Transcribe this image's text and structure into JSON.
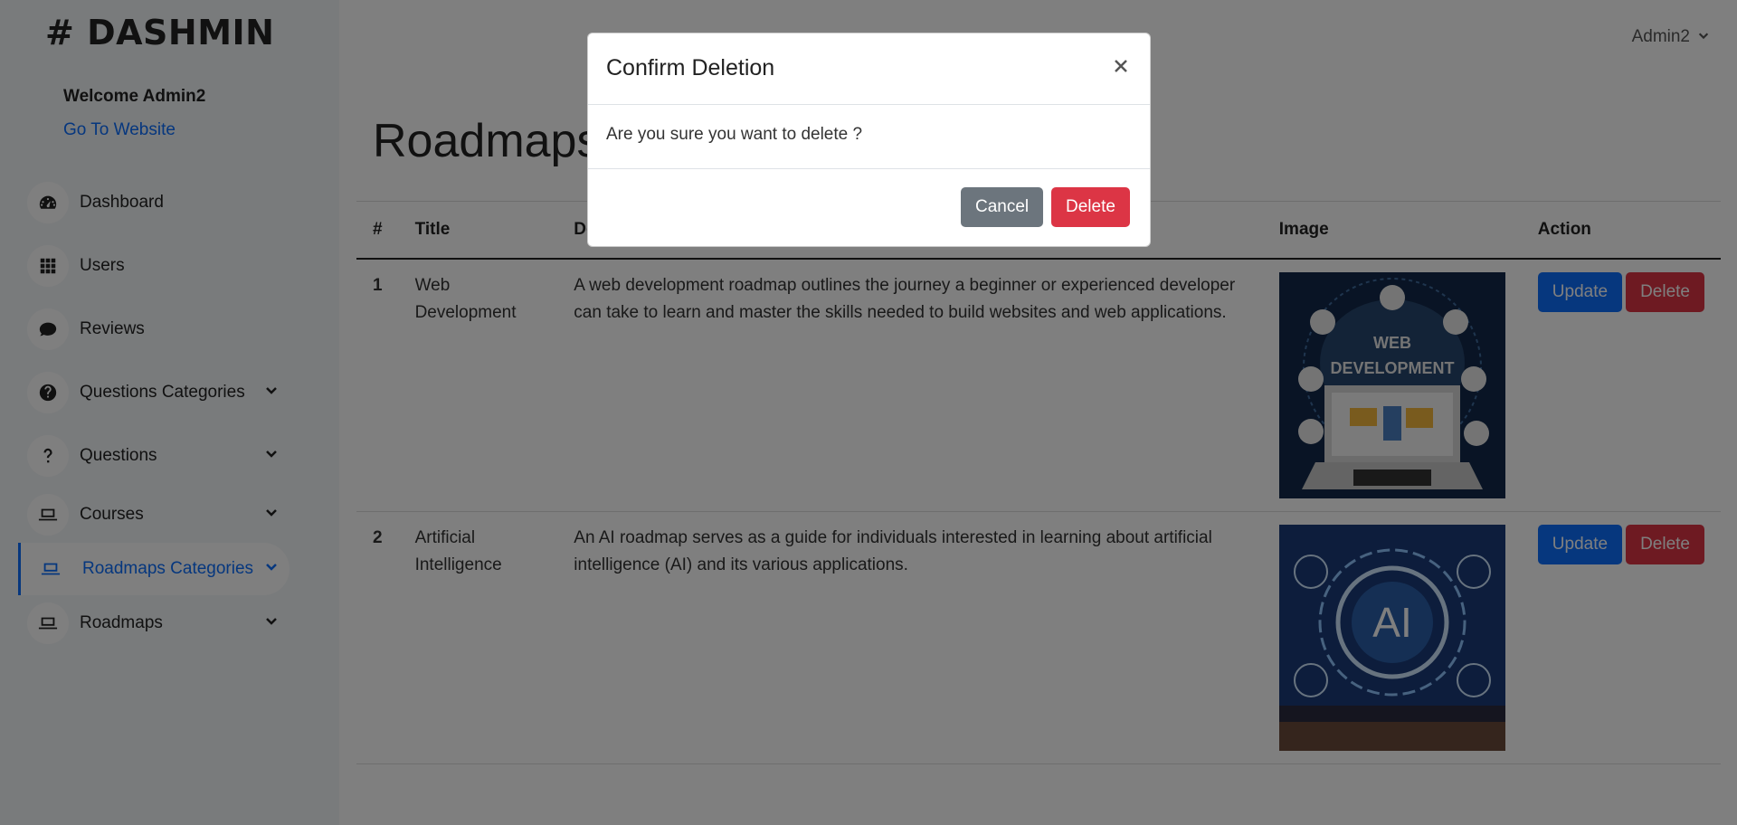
{
  "brand": {
    "title": "# DASHMIN"
  },
  "sidebar": {
    "welcome": "Welcome Admin2",
    "go_to_website": "Go To Website",
    "items": [
      {
        "label": "Dashboard",
        "icon": "dashboard-icon"
      },
      {
        "label": "Users",
        "icon": "grid-icon"
      },
      {
        "label": "Reviews",
        "icon": "comment-icon"
      },
      {
        "label": "Questions Categories",
        "icon": "question-circle-icon"
      },
      {
        "label": "Questions",
        "icon": "question-icon"
      },
      {
        "label": "Courses",
        "icon": "laptop-icon"
      },
      {
        "label": "Roadmaps Categories",
        "icon": "laptop-icon"
      },
      {
        "label": "Roadmaps",
        "icon": "laptop-icon"
      }
    ],
    "active": "Roadmaps Categories"
  },
  "topbar": {
    "user": "Admin2"
  },
  "page": {
    "title": "Roadmaps"
  },
  "table": {
    "headers": [
      "#",
      "Title",
      "Description",
      "Image",
      "Action"
    ],
    "rows": [
      {
        "num": "1",
        "title": "Web Development",
        "description": "A web development roadmap outlines the journey a beginner or experienced developer can take to learn and master the skills needed to build websites and web applications.",
        "image_caption_1": "WEB",
        "image_caption_2": "DEVELOPMENT",
        "update": "Update",
        "delete": "Delete"
      },
      {
        "num": "2",
        "title": "Artificial Intelligence",
        "description": "An AI roadmap serves as a guide for individuals interested in learning about artificial intelligence (AI) and its various applications.",
        "image_caption_1": "AI",
        "update": "Update",
        "delete": "Delete"
      }
    ]
  },
  "modal": {
    "title": "Confirm Deletion",
    "message": "Are you sure you want to delete ?",
    "cancel": "Cancel",
    "confirm": "Delete"
  },
  "colors": {
    "primary": "#0d6efd",
    "danger": "#dc3545",
    "secondary": "#6c757d",
    "backdrop": "rgba(0,0,0,0.5)"
  }
}
